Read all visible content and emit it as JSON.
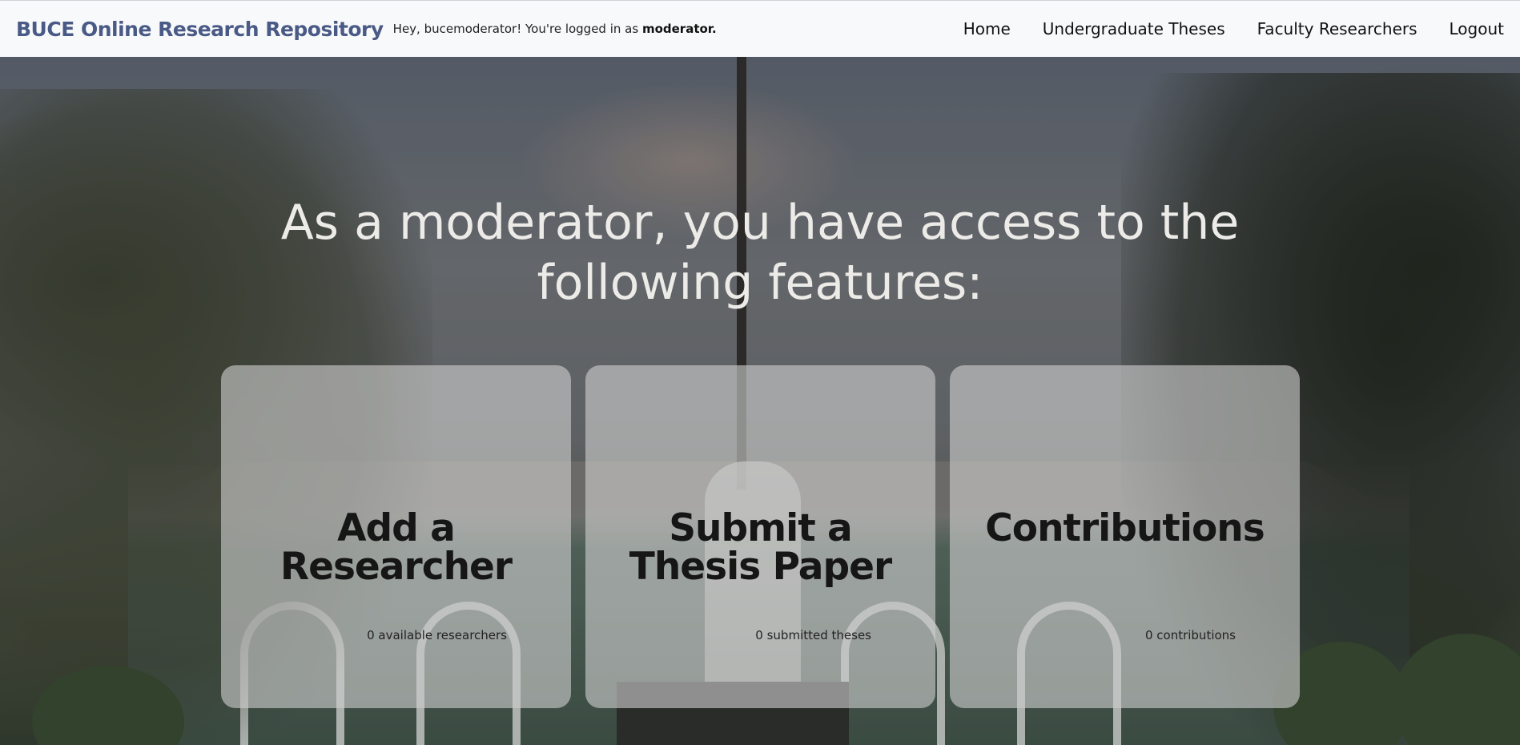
{
  "navbar": {
    "brand": "BUCE Online Research Repository",
    "greeting_prefix": "Hey, bucemoderator! You're logged in as",
    "greeting_role": "moderator.",
    "links": [
      "Home",
      "Undergraduate Theses",
      "Faculty Researchers",
      "Logout"
    ]
  },
  "hero": {
    "headline_line1": "As a moderator, you have access to the",
    "headline_line2": "following features:"
  },
  "cards": [
    {
      "title_line1": "Add a",
      "title_line2": "Researcher",
      "count": "0 available researchers"
    },
    {
      "title_line1": "Submit a",
      "title_line2": "Thesis Paper",
      "count": "0 submitted theses"
    },
    {
      "title_line1": "Contributions",
      "title_line2": "",
      "count": "0 contributions"
    }
  ],
  "colors": {
    "brand": "#4a5a86",
    "navbar_bg": "#f8f9fa"
  }
}
